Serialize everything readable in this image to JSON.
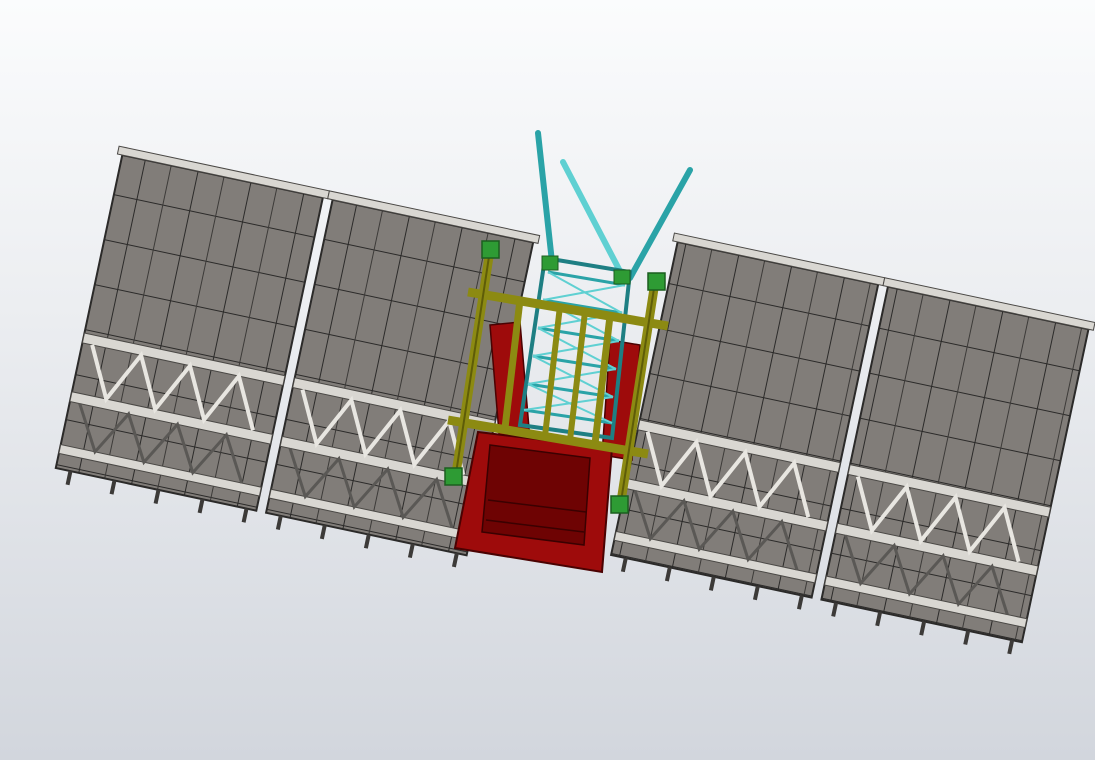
{
  "viewport": {
    "background_top": "#fbfcfd",
    "background_bottom": "#d2d6dd"
  },
  "model": {
    "colors": {
      "wall_panel": "#817d79",
      "wall_frame": "#2b2a29",
      "wall_rail": "#d9d7d2",
      "truss_member": "#e8e6e1",
      "mast_frame": "#8c8a12",
      "mast_frame_dark": "#5e5c08",
      "hoist_body": "#9e0b0b",
      "hoist_body_dark": "#6e0303",
      "climbing_frame": "#2aa3a7",
      "climbing_frame_light": "#5fd0d2",
      "connector_block": "#2e9b34"
    }
  }
}
